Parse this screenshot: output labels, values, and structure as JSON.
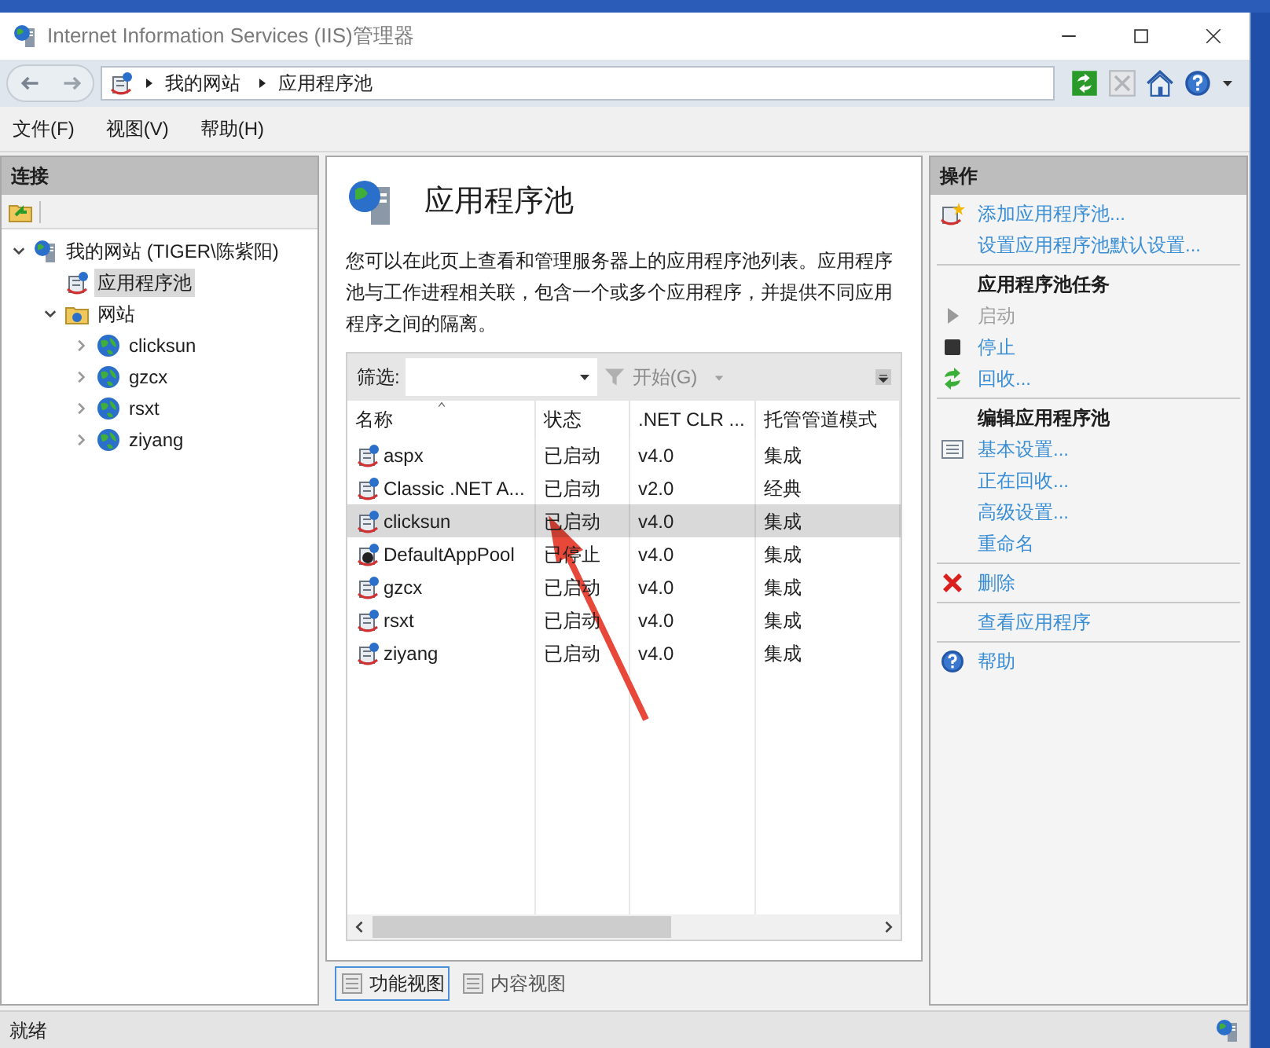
{
  "window": {
    "title": "Internet Information Services (IIS)管理器"
  },
  "address": {
    "breadcrumb": [
      "我的网站",
      "应用程序池"
    ]
  },
  "menu": [
    "文件(F)",
    "视图(V)",
    "帮助(H)"
  ],
  "connections": {
    "title": "连接",
    "tree": [
      {
        "label": "我的网站 (TIGER\\陈紫阳)",
        "kind": "server",
        "expanded": true,
        "selected": false,
        "children": [
          {
            "label": "应用程序池",
            "kind": "pool",
            "selected": true
          },
          {
            "label": "网站",
            "kind": "folder",
            "expanded": true,
            "selected": false,
            "children": [
              {
                "label": "clicksun",
                "kind": "site",
                "expanded": false,
                "selected": false
              },
              {
                "label": "gzcx",
                "kind": "site",
                "expanded": false,
                "selected": false
              },
              {
                "label": "rsxt",
                "kind": "site",
                "expanded": false,
                "selected": false
              },
              {
                "label": "ziyang",
                "kind": "site",
                "expanded": false,
                "selected": false
              }
            ]
          }
        ]
      }
    ]
  },
  "main": {
    "title": "应用程序池",
    "description": "您可以在此页上查看和管理服务器上的应用程序池列表。应用程序池与工作进程相关联，包含一个或多个应用程序，并提供不同应用程序之间的隔离。",
    "filter": {
      "label": "筛选:",
      "go": "开始(G)"
    },
    "columns": [
      "名称",
      "状态",
      ".NET CLR ...",
      "托管管道模式"
    ],
    "rows": [
      {
        "name": "aspx",
        "status": "已启动",
        "clr": "v4.0",
        "mode": "集成",
        "kind": "running",
        "selected": false
      },
      {
        "name": "Classic .NET A...",
        "status": "已启动",
        "clr": "v2.0",
        "mode": "经典",
        "kind": "running",
        "selected": false
      },
      {
        "name": "clicksun",
        "status": "已启动",
        "clr": "v4.0",
        "mode": "集成",
        "kind": "running",
        "selected": true
      },
      {
        "name": "DefaultAppPool",
        "status": "已停止",
        "clr": "v4.0",
        "mode": "集成",
        "kind": "stopped",
        "selected": false
      },
      {
        "name": "gzcx",
        "status": "已启动",
        "clr": "v4.0",
        "mode": "集成",
        "kind": "running",
        "selected": false
      },
      {
        "name": "rsxt",
        "status": "已启动",
        "clr": "v4.0",
        "mode": "集成",
        "kind": "running",
        "selected": false
      },
      {
        "name": "ziyang",
        "status": "已启动",
        "clr": "v4.0",
        "mode": "集成",
        "kind": "running",
        "selected": false
      }
    ]
  },
  "view_tabs": [
    {
      "label": "功能视图",
      "selected": true
    },
    {
      "label": "内容视图",
      "selected": false
    }
  ],
  "actions": {
    "title": "操作",
    "groups": [
      [
        {
          "kind": "add",
          "label": "添加应用程序池...",
          "disabled": false
        },
        {
          "kind": "link",
          "label": "设置应用程序池默认设置...",
          "disabled": false
        }
      ],
      [
        {
          "kind": "heading",
          "label": "应用程序池任务"
        },
        {
          "kind": "start",
          "label": "启动",
          "disabled": true
        },
        {
          "kind": "stop",
          "label": "停止",
          "disabled": false
        },
        {
          "kind": "recycle",
          "label": "回收...",
          "disabled": false
        }
      ],
      [
        {
          "kind": "heading",
          "label": "编辑应用程序池"
        },
        {
          "kind": "settings",
          "label": "基本设置...",
          "disabled": false
        },
        {
          "kind": "link",
          "label": "正在回收...",
          "disabled": false
        },
        {
          "kind": "link",
          "label": "高级设置...",
          "disabled": false
        },
        {
          "kind": "link",
          "label": "重命名",
          "disabled": false
        }
      ],
      [
        {
          "kind": "delete",
          "label": "删除",
          "disabled": false
        }
      ],
      [
        {
          "kind": "link",
          "label": "查看应用程序",
          "disabled": false
        }
      ],
      [
        {
          "kind": "help",
          "label": "帮助",
          "disabled": false
        }
      ]
    ]
  },
  "status_bar": {
    "text": "就绪"
  }
}
